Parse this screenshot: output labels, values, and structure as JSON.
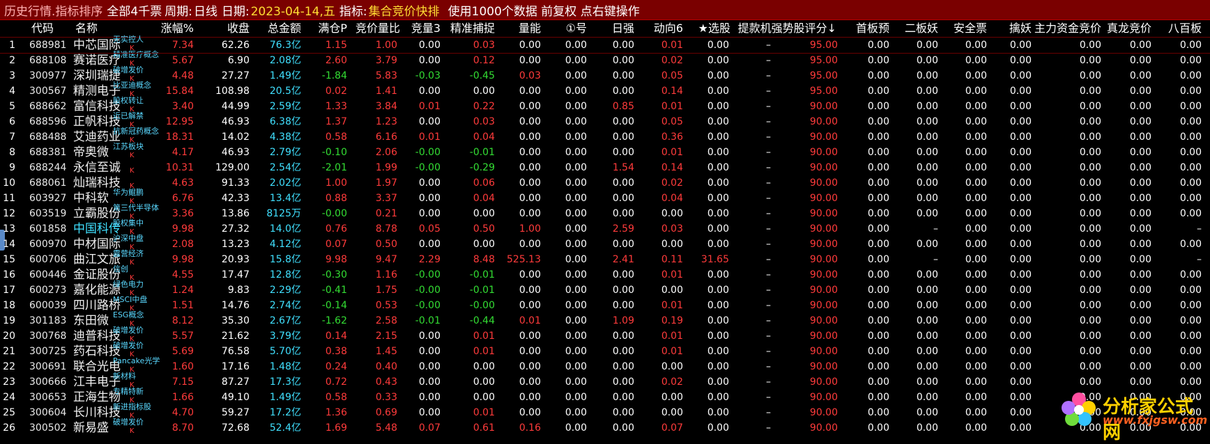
{
  "topbar": {
    "title": "历史行情.指标排序",
    "scope": "全部4千票",
    "period_label": "周期:",
    "period_value": "日线",
    "date_label": "日期:",
    "date_value": "2023-04-14,五",
    "indicator_label": "指标:",
    "indicator_value": "集合竞价快排",
    "hint": "使用1000个数据 前复权 点右键操作"
  },
  "columns": [
    "代码",
    "名称",
    "涨幅%",
    "收盘",
    "总金额",
    "满仓P",
    "竞价量比",
    "竞量3",
    "精准捕捉",
    "量能",
    "①号",
    "日强",
    "动向6",
    "★选股",
    "提款机强势股评分↓",
    "首板预",
    "二板妖",
    "安全票",
    "擒妖",
    "主力资金竞价",
    "真龙竞价",
    "八百板"
  ],
  "rows": [
    {
      "no": "1",
      "code": "688981",
      "name": "中芯国际",
      "tag": "无实控人",
      "change": "7.34",
      "close": "62.26",
      "amount": "76.3亿",
      "mc": "1.15",
      "jjlb": "1.00",
      "jl3": "0.00",
      "jzbz": "0.03",
      "ln": "0.00",
      "h1": "0.00",
      "rq": "0.00",
      "dx6": "0.01",
      "xg": "0.00",
      "tkj": "–",
      "score": "95.00",
      "sbyu": "0.00",
      "ebyao": "0.00",
      "aqp": "0.00",
      "qy": "0.00",
      "zljj": "0.00",
      "zljing": "0.00",
      "bbb": "0.00"
    },
    {
      "no": "2",
      "code": "688108",
      "name": "赛诺医疗",
      "tag": "精准医疗概念",
      "change": "5.67",
      "close": "6.90",
      "amount": "2.08亿",
      "mc": "2.60",
      "jjlb": "3.79",
      "jl3": "0.00",
      "jzbz": "0.12",
      "ln": "0.00",
      "h1": "0.00",
      "rq": "0.00",
      "dx6": "0.02",
      "xg": "0.00",
      "tkj": "–",
      "score": "95.00",
      "sbyu": "0.00",
      "ebyao": "0.00",
      "aqp": "0.00",
      "qy": "0.00",
      "zljj": "0.00",
      "zljing": "0.00",
      "bbb": "0.00"
    },
    {
      "no": "3",
      "code": "300977",
      "name": "深圳瑞捷",
      "tag": "破增发价",
      "change": "4.48",
      "close": "27.27",
      "amount": "1.49亿",
      "mc": "-1.84",
      "jjlb": "5.83",
      "jl3": "-0.03",
      "jzbz": "-0.45",
      "ln": "0.03",
      "h1": "0.00",
      "rq": "0.00",
      "dx6": "0.05",
      "xg": "0.00",
      "tkj": "–",
      "score": "95.00",
      "sbyu": "0.00",
      "ebyao": "0.00",
      "aqp": "0.00",
      "qy": "0.00",
      "zljj": "0.00",
      "zljing": "0.00",
      "bbb": "0.00"
    },
    {
      "no": "4",
      "code": "300567",
      "name": "精测电子",
      "tag": "比亚迪概念",
      "change": "15.84",
      "close": "108.98",
      "amount": "20.5亿",
      "mc": "0.02",
      "jjlb": "1.41",
      "jl3": "0.00",
      "jzbz": "0.00",
      "ln": "0.00",
      "h1": "0.00",
      "rq": "0.00",
      "dx6": "0.14",
      "xg": "0.00",
      "tkj": "–",
      "score": "95.00",
      "sbyu": "0.00",
      "ebyao": "0.00",
      "aqp": "0.00",
      "qy": "0.00",
      "zljj": "0.00",
      "zljing": "0.00",
      "bbb": "0.00"
    },
    {
      "no": "5",
      "code": "688662",
      "name": "富信科技",
      "tag": "股权转让",
      "change": "3.40",
      "close": "44.99",
      "amount": "2.59亿",
      "mc": "1.33",
      "jjlb": "3.84",
      "jl3": "0.01",
      "jzbz": "0.22",
      "ln": "0.00",
      "h1": "0.00",
      "rq": "0.85",
      "dx6": "0.01",
      "xg": "0.00",
      "tkj": "–",
      "score": "90.00",
      "sbyu": "0.00",
      "ebyao": "0.00",
      "aqp": "0.00",
      "qy": "0.00",
      "zljj": "0.00",
      "zljing": "0.00",
      "bbb": "0.00"
    },
    {
      "no": "6",
      "code": "688596",
      "name": "正帆科技",
      "tag": "近已解禁",
      "change": "12.95",
      "close": "46.93",
      "amount": "6.38亿",
      "mc": "1.37",
      "jjlb": "1.23",
      "jl3": "0.00",
      "jzbz": "0.03",
      "ln": "0.00",
      "h1": "0.00",
      "rq": "0.00",
      "dx6": "0.05",
      "xg": "0.00",
      "tkj": "–",
      "score": "90.00",
      "sbyu": "0.00",
      "ebyao": "0.00",
      "aqp": "0.00",
      "qy": "0.00",
      "zljj": "0.00",
      "zljing": "0.00",
      "bbb": "0.00"
    },
    {
      "no": "7",
      "code": "688488",
      "name": "艾迪药业",
      "tag": "抗新冠药概念",
      "change": "18.31",
      "close": "14.02",
      "amount": "4.38亿",
      "mc": "0.58",
      "jjlb": "6.16",
      "jl3": "0.01",
      "jzbz": "0.04",
      "ln": "0.00",
      "h1": "0.00",
      "rq": "0.00",
      "dx6": "0.36",
      "xg": "0.00",
      "tkj": "–",
      "score": "90.00",
      "sbyu": "0.00",
      "ebyao": "0.00",
      "aqp": "0.00",
      "qy": "0.00",
      "zljj": "0.00",
      "zljing": "0.00",
      "bbb": "0.00"
    },
    {
      "no": "8",
      "code": "688381",
      "name": "帝奥微",
      "tag": "江苏板块",
      "change": "4.17",
      "close": "46.93",
      "amount": "2.79亿",
      "mc": "-0.10",
      "jjlb": "2.06",
      "jl3": "-0.00",
      "jzbz": "-0.01",
      "ln": "0.00",
      "h1": "0.00",
      "rq": "0.00",
      "dx6": "0.01",
      "xg": "0.00",
      "tkj": "–",
      "score": "90.00",
      "sbyu": "0.00",
      "ebyao": "0.00",
      "aqp": "0.00",
      "qy": "0.00",
      "zljj": "0.00",
      "zljing": "0.00",
      "bbb": "0.00"
    },
    {
      "no": "9",
      "code": "688244",
      "name": "永信至诚",
      "tag": "",
      "change": "10.31",
      "close": "129.00",
      "amount": "2.54亿",
      "mc": "-2.01",
      "jjlb": "1.99",
      "jl3": "-0.00",
      "jzbz": "-0.29",
      "ln": "0.00",
      "h1": "0.00",
      "rq": "1.54",
      "dx6": "0.14",
      "xg": "0.00",
      "tkj": "–",
      "score": "90.00",
      "sbyu": "0.00",
      "ebyao": "0.00",
      "aqp": "0.00",
      "qy": "0.00",
      "zljj": "0.00",
      "zljing": "0.00",
      "bbb": "0.00"
    },
    {
      "no": "10",
      "code": "688061",
      "name": "灿瑞科技",
      "tag": "",
      "change": "4.63",
      "close": "91.33",
      "amount": "2.02亿",
      "mc": "1.00",
      "jjlb": "1.97",
      "jl3": "0.00",
      "jzbz": "0.06",
      "ln": "0.00",
      "h1": "0.00",
      "rq": "0.00",
      "dx6": "0.02",
      "xg": "0.00",
      "tkj": "–",
      "score": "90.00",
      "sbyu": "0.00",
      "ebyao": "0.00",
      "aqp": "0.00",
      "qy": "0.00",
      "zljj": "0.00",
      "zljing": "0.00",
      "bbb": "0.00"
    },
    {
      "no": "11",
      "code": "603927",
      "name": "中科软",
      "tag": "华为鲲鹏",
      "change": "6.76",
      "close": "42.33",
      "amount": "13.4亿",
      "mc": "0.88",
      "jjlb": "3.37",
      "jl3": "0.00",
      "jzbz": "0.04",
      "ln": "0.00",
      "h1": "0.00",
      "rq": "0.00",
      "dx6": "0.04",
      "xg": "0.00",
      "tkj": "–",
      "score": "90.00",
      "sbyu": "0.00",
      "ebyao": "0.00",
      "aqp": "0.00",
      "qy": "0.00",
      "zljj": "0.00",
      "zljing": "0.00",
      "bbb": "0.00"
    },
    {
      "no": "12",
      "code": "603519",
      "name": "立霸股份",
      "tag": "第三代半导体",
      "change": "3.36",
      "close": "13.86",
      "amount": "8125万",
      "mc": "-0.00",
      "jjlb": "0.21",
      "jl3": "0.00",
      "jzbz": "0.00",
      "ln": "0.00",
      "h1": "0.00",
      "rq": "0.00",
      "dx6": "0.00",
      "xg": "0.00",
      "tkj": "–",
      "score": "90.00",
      "sbyu": "0.00",
      "ebyao": "0.00",
      "aqp": "0.00",
      "qy": "0.00",
      "zljj": "0.00",
      "zljing": "0.00",
      "bbb": "0.00"
    },
    {
      "no": "13",
      "code": "601858",
      "name": "中国科传",
      "tag": "股权集中",
      "change": "9.98",
      "close": "27.32",
      "amount": "14.0亿",
      "mc": "0.76",
      "jjlb": "8.78",
      "jl3": "0.05",
      "jzbz": "0.50",
      "ln": "1.00",
      "h1": "0.00",
      "rq": "2.59",
      "dx6": "0.03",
      "xg": "0.00",
      "tkj": "–",
      "score": "90.00",
      "sbyu": "0.00",
      "ebyao": "–",
      "aqp": "0.00",
      "qy": "0.00",
      "zljj": "0.00",
      "zljing": "0.00",
      "bbb": "–"
    },
    {
      "no": "14",
      "code": "600970",
      "name": "中材国际",
      "tag": "沪深中盘",
      "change": "2.08",
      "close": "13.23",
      "amount": "4.12亿",
      "mc": "0.07",
      "jjlb": "0.50",
      "jl3": "0.00",
      "jzbz": "0.00",
      "ln": "0.00",
      "h1": "0.00",
      "rq": "0.00",
      "dx6": "0.00",
      "xg": "0.00",
      "tkj": "–",
      "score": "90.00",
      "sbyu": "0.00",
      "ebyao": "0.00",
      "aqp": "0.00",
      "qy": "0.00",
      "zljj": "0.00",
      "zljing": "0.00",
      "bbb": "0.00"
    },
    {
      "no": "15",
      "code": "600706",
      "name": "曲江文旅",
      "tag": "露营经济",
      "change": "9.98",
      "close": "20.93",
      "amount": "15.8亿",
      "mc": "9.98",
      "jjlb": "9.47",
      "jl3": "2.29",
      "jzbz": "8.48",
      "ln": "525.13",
      "h1": "0.00",
      "rq": "2.41",
      "dx6": "0.11",
      "xg": "31.65",
      "tkj": "–",
      "score": "90.00",
      "sbyu": "0.00",
      "ebyao": "–",
      "aqp": "0.00",
      "qy": "0.00",
      "zljj": "0.00",
      "zljing": "0.00",
      "bbb": "–"
    },
    {
      "no": "16",
      "code": "600446",
      "name": "金证股份",
      "tag": "信创",
      "change": "4.55",
      "close": "17.47",
      "amount": "12.8亿",
      "mc": "-0.30",
      "jjlb": "1.16",
      "jl3": "-0.00",
      "jzbz": "-0.01",
      "ln": "0.00",
      "h1": "0.00",
      "rq": "0.00",
      "dx6": "0.01",
      "xg": "0.00",
      "tkj": "–",
      "score": "90.00",
      "sbyu": "0.00",
      "ebyao": "0.00",
      "aqp": "0.00",
      "qy": "0.00",
      "zljj": "0.00",
      "zljing": "0.00",
      "bbb": "0.00"
    },
    {
      "no": "17",
      "code": "600273",
      "name": "嘉化能源",
      "tag": "绿色电力",
      "change": "1.24",
      "close": "9.83",
      "amount": "2.29亿",
      "mc": "-0.41",
      "jjlb": "1.75",
      "jl3": "-0.00",
      "jzbz": "-0.01",
      "ln": "0.00",
      "h1": "0.00",
      "rq": "0.00",
      "dx6": "0.00",
      "xg": "0.00",
      "tkj": "–",
      "score": "90.00",
      "sbyu": "0.00",
      "ebyao": "0.00",
      "aqp": "0.00",
      "qy": "0.00",
      "zljj": "0.00",
      "zljing": "0.00",
      "bbb": "0.00"
    },
    {
      "no": "18",
      "code": "600039",
      "name": "四川路桥",
      "tag": "MSCI中盘",
      "change": "1.51",
      "close": "14.76",
      "amount": "2.74亿",
      "mc": "-0.14",
      "jjlb": "0.53",
      "jl3": "-0.00",
      "jzbz": "-0.00",
      "ln": "0.00",
      "h1": "0.00",
      "rq": "0.00",
      "dx6": "0.01",
      "xg": "0.00",
      "tkj": "–",
      "score": "90.00",
      "sbyu": "0.00",
      "ebyao": "0.00",
      "aqp": "0.00",
      "qy": "0.00",
      "zljj": "0.00",
      "zljing": "0.00",
      "bbb": "0.00"
    },
    {
      "no": "19",
      "code": "301183",
      "name": "东田微",
      "tag": "ESG概念",
      "change": "8.12",
      "close": "35.30",
      "amount": "2.67亿",
      "mc": "-1.62",
      "jjlb": "2.58",
      "jl3": "-0.01",
      "jzbz": "-0.44",
      "ln": "0.01",
      "h1": "0.00",
      "rq": "1.09",
      "dx6": "0.19",
      "xg": "0.00",
      "tkj": "–",
      "score": "90.00",
      "sbyu": "0.00",
      "ebyao": "0.00",
      "aqp": "0.00",
      "qy": "0.00",
      "zljj": "0.00",
      "zljing": "0.00",
      "bbb": "0.00"
    },
    {
      "no": "20",
      "code": "300768",
      "name": "迪普科技",
      "tag": "破增发价",
      "change": "5.57",
      "close": "21.62",
      "amount": "3.79亿",
      "mc": "0.14",
      "jjlb": "2.15",
      "jl3": "0.00",
      "jzbz": "0.01",
      "ln": "0.00",
      "h1": "0.00",
      "rq": "0.00",
      "dx6": "0.01",
      "xg": "0.00",
      "tkj": "–",
      "score": "90.00",
      "sbyu": "0.00",
      "ebyao": "0.00",
      "aqp": "0.00",
      "qy": "0.00",
      "zljj": "0.00",
      "zljing": "0.00",
      "bbb": "0.00"
    },
    {
      "no": "21",
      "code": "300725",
      "name": "药石科技",
      "tag": "破增发价",
      "change": "5.69",
      "close": "76.58",
      "amount": "5.70亿",
      "mc": "0.38",
      "jjlb": "1.45",
      "jl3": "0.00",
      "jzbz": "0.01",
      "ln": "0.00",
      "h1": "0.00",
      "rq": "0.00",
      "dx6": "0.01",
      "xg": "0.00",
      "tkj": "–",
      "score": "90.00",
      "sbyu": "0.00",
      "ebyao": "0.00",
      "aqp": "0.00",
      "qy": "0.00",
      "zljj": "0.00",
      "zljing": "0.00",
      "bbb": "0.00"
    },
    {
      "no": "22",
      "code": "300691",
      "name": "联合光电",
      "tag": "Pancake光学",
      "change": "1.60",
      "close": "17.16",
      "amount": "1.48亿",
      "mc": "0.24",
      "jjlb": "0.40",
      "jl3": "0.00",
      "jzbz": "0.00",
      "ln": "0.00",
      "h1": "0.00",
      "rq": "0.00",
      "dx6": "0.00",
      "xg": "0.00",
      "tkj": "–",
      "score": "90.00",
      "sbyu": "0.00",
      "ebyao": "0.00",
      "aqp": "0.00",
      "qy": "0.00",
      "zljj": "0.00",
      "zljing": "0.00",
      "bbb": "0.00"
    },
    {
      "no": "23",
      "code": "300666",
      "name": "江丰电子",
      "tag": "新材料",
      "change": "7.15",
      "close": "87.27",
      "amount": "17.3亿",
      "mc": "0.72",
      "jjlb": "0.43",
      "jl3": "0.00",
      "jzbz": "0.00",
      "ln": "0.00",
      "h1": "0.00",
      "rq": "0.00",
      "dx6": "0.02",
      "xg": "0.00",
      "tkj": "–",
      "score": "90.00",
      "sbyu": "0.00",
      "ebyao": "0.00",
      "aqp": "0.00",
      "qy": "0.00",
      "zljj": "0.00",
      "zljing": "0.00",
      "bbb": "0.00"
    },
    {
      "no": "24",
      "code": "300653",
      "name": "正海生物",
      "tag": "专精特新",
      "change": "1.66",
      "close": "49.10",
      "amount": "1.49亿",
      "mc": "0.58",
      "jjlb": "0.33",
      "jl3": "0.00",
      "jzbz": "0.00",
      "ln": "0.00",
      "h1": "0.00",
      "rq": "0.00",
      "dx6": "0.00",
      "xg": "0.00",
      "tkj": "–",
      "score": "90.00",
      "sbyu": "0.00",
      "ebyao": "0.00",
      "aqp": "0.00",
      "qy": "0.00",
      "zljj": "0.00",
      "zljing": "0.00",
      "bbb": "0.00"
    },
    {
      "no": "25",
      "code": "300604",
      "name": "长川科技",
      "tag": "新进指标股",
      "change": "4.70",
      "close": "59.27",
      "amount": "17.2亿",
      "mc": "1.36",
      "jjlb": "0.69",
      "jl3": "0.00",
      "jzbz": "0.01",
      "ln": "0.00",
      "h1": "0.00",
      "rq": "0.00",
      "dx6": "0.00",
      "xg": "0.00",
      "tkj": "–",
      "score": "90.00",
      "sbyu": "0.00",
      "ebyao": "0.00",
      "aqp": "0.00",
      "qy": "0.00",
      "zljj": "0.00",
      "zljing": "0.00",
      "bbb": "0.00"
    },
    {
      "no": "26",
      "code": "300502",
      "name": "新易盛",
      "tag": "破增发价",
      "change": "8.70",
      "close": "72.68",
      "amount": "52.4亿",
      "mc": "1.69",
      "jjlb": "5.48",
      "jl3": "0.07",
      "jzbz": "0.61",
      "ln": "0.16",
      "h1": "0.00",
      "rq": "0.00",
      "dx6": "0.07",
      "xg": "0.00",
      "tkj": "–",
      "score": "90.00",
      "sbyu": "0.00",
      "ebyao": "0.00",
      "aqp": "0.00",
      "qy": "0.00",
      "zljj": "0.00",
      "zljing": "0.00",
      "bbb": "0.00"
    }
  ],
  "watermark": {
    "title": "分析家公式网",
    "url": "www.fxjgsw.com"
  }
}
